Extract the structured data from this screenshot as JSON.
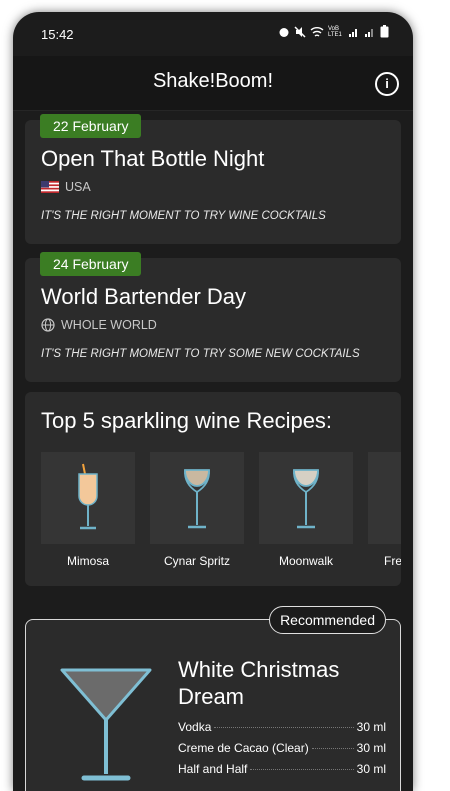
{
  "status": {
    "time": "15:42",
    "network_label": "VoB LTE1"
  },
  "appbar": {
    "title": "Shake!Boom!",
    "info_icon": "info-icon"
  },
  "events": [
    {
      "date": "22 February",
      "title": "Open That Bottle Night",
      "country": "USA",
      "country_icon": "us-flag-icon",
      "note": "IT'S THE RIGHT MOMENT TO TRY WINE COCKTAILS"
    },
    {
      "date": "24 February",
      "title": "World Bartender Day",
      "country": "WHOLE WORLD",
      "country_icon": "globe-icon",
      "note": "IT'S THE RIGHT MOMENT TO TRY SOME NEW COCKTAILS"
    }
  ],
  "top_recipes": {
    "title": "Top 5 sparkling wine Recipes:",
    "items": [
      {
        "name": "Mimosa",
        "icon": "mimosa-glass-icon"
      },
      {
        "name": "Cynar Spritz",
        "icon": "wine-glass-icon"
      },
      {
        "name": "Moonwalk",
        "icon": "wine-glass-icon"
      },
      {
        "name": "Fre",
        "icon": "glass-icon"
      }
    ]
  },
  "recommended": {
    "badge": "Recommended",
    "title": "White Christmas Dream",
    "icon": "martini-glass-icon",
    "ingredients": [
      {
        "name": "Vodka",
        "amount": "30 ml"
      },
      {
        "name": "Creme de Cacao (Clear)",
        "amount": "30 ml"
      },
      {
        "name": "Half and Half",
        "amount": "30 ml"
      }
    ]
  }
}
